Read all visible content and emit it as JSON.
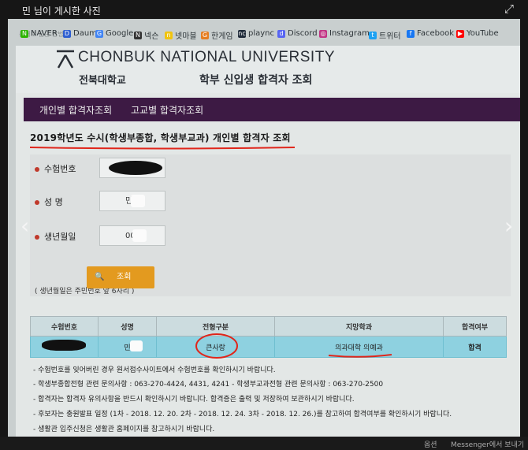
{
  "viewer": {
    "title": "민 님이 게시한 사진",
    "url": "jbnu.ac.kr/jbnu/exam/esin/2019SusiPassNotice.html",
    "expand_icon": "expand-icon",
    "prev_icon": "chevron-left-icon",
    "next_icon": "chevron-right-icon",
    "options_label": "옵션",
    "messenger_label": "Messenger에서 보내기"
  },
  "bookmarks": {
    "apps_hint": "중개로 접근 방법",
    "items": [
      {
        "label": "NAVER",
        "color": "#2db400"
      },
      {
        "label": "Daum",
        "color": "#2f5fd0"
      },
      {
        "label": "Google",
        "color": "#4285f4"
      },
      {
        "label": "넥슨",
        "color": "#333333"
      },
      {
        "label": "넷마블",
        "color": "#f1c40f"
      },
      {
        "label": "한게임",
        "color": "#e67e22"
      },
      {
        "label": "plaync",
        "color": "#1f2b3a"
      },
      {
        "label": "Discord",
        "color": "#5865f2"
      },
      {
        "label": "Instagram",
        "color": "#c13584"
      },
      {
        "label": "트위터",
        "color": "#1da1f2"
      },
      {
        "label": "Facebook",
        "color": "#1877f2"
      },
      {
        "label": "YouTube",
        "color": "#ff0000"
      }
    ]
  },
  "header": {
    "university_en": "CHONBUK NATIONAL UNIVERSITY",
    "university_ko": "전북대학교",
    "page_heading": "학부 신입생 합격자 조회"
  },
  "nav": {
    "tabs": [
      {
        "label": "개인별 합격자조회"
      },
      {
        "label": "고교별 합격자조회"
      }
    ],
    "color": "#3d1a44"
  },
  "section_title": "2019학년도 수시(학생부종합, 학생부교과) 개인별 합격자 조회",
  "form": {
    "exam_number_label": "수험번호",
    "name_label": "성  명",
    "name_value": "민",
    "birth_label": "생년월일",
    "birth_value": "00",
    "birth_hint": "( 생년월일은 주민번호 앞 6자리 )",
    "search_label": "조회",
    "search_icon": "search-icon"
  },
  "results": {
    "headers": [
      "수험번호",
      "성명",
      "전형구분",
      "지망학과",
      "합격여부"
    ],
    "row": {
      "name": "민",
      "admission_type": "큰사랑",
      "department": "의과대학 의예과",
      "result": "합격"
    },
    "row_color": "#8ed1e0"
  },
  "notes": [
    "- 수험번호를 잊어버린 경우 원서접수사이트에서 수험번호를 확인하시기 바랍니다.",
    "- 학생부종합전형 관련 문의사항 : 063-270-4424, 4431, 4241  - 학생부교과전형 관련 문의사항 : 063-270-2500",
    "- 합격자는 합격자 유의사항을 반드시 확인하시기 바랍니다. 합격증은 출력 및 저장하여 보관하시기 바랍니다.",
    "- 후보자는 충원발표 일정 (1차 - 2018. 12. 20.  2차 - 2018. 12. 24.  3차 - 2018. 12. 26.)를 참고하여 합격여부를 확인하시기 바랍니다.",
    "- 생활관 입주신청은 생활관 홈페이지를 참고하시기 바랍니다."
  ]
}
